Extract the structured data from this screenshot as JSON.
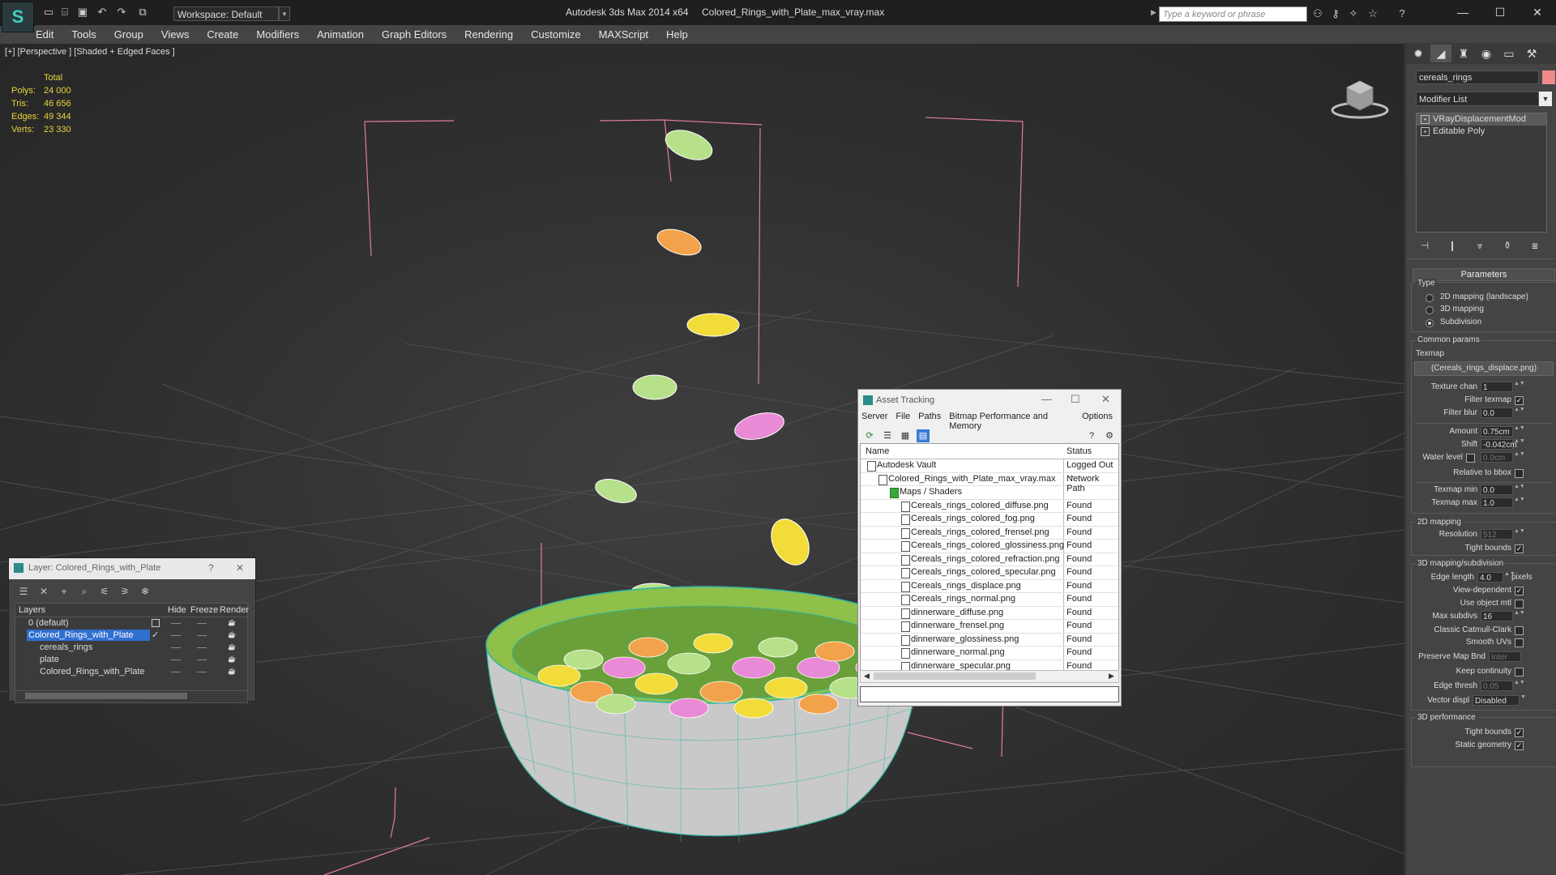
{
  "title_bar": {
    "app_title": "Autodesk 3ds Max  2014 x64",
    "file_title": "Colored_Rings_with_Plate_max_vray.max",
    "workspace": "Workspace: Default",
    "search_placeholder": "Type a keyword or phrase",
    "window_controls": {
      "minimize": "—",
      "maximize": "☐",
      "close": "✕"
    }
  },
  "menu": [
    "Edit",
    "Tools",
    "Group",
    "Views",
    "Create",
    "Modifiers",
    "Animation",
    "Graph Editors",
    "Rendering",
    "Customize",
    "MAXScript",
    "Help"
  ],
  "viewport": {
    "label": "[+] [Perspective ] [Shaded + Edged Faces ]",
    "stats": {
      "header": "Total",
      "rows": [
        {
          "label": "Polys:",
          "value": "24 000"
        },
        {
          "label": "Tris:",
          "value": "46 656"
        },
        {
          "label": "Edges:",
          "value": "49 344"
        },
        {
          "label": "Verts:",
          "value": "23 330"
        }
      ]
    },
    "ring_colors": {
      "green": "#b6e08a",
      "orange": "#f2a24a",
      "yellow": "#f2dc3a",
      "pink": "#e98ad6"
    }
  },
  "command_panel": {
    "object_name": "cereals_rings",
    "object_color": "#f08a8a",
    "modifier_list": "Modifier List",
    "stack": [
      "VRayDisplacementMod",
      "Editable Poly"
    ],
    "parameters_title": "Parameters",
    "type_label": "Type",
    "type_options": [
      "2D mapping (landscape)",
      "3D mapping",
      "Subdivision"
    ],
    "common_params": "Common params",
    "texmap_label": "Texmap",
    "texmap_value": "(Cereals_rings_displace.png)",
    "texture_chan": {
      "label": "Texture chan",
      "value": "1"
    },
    "filter_texmap": "Filter texmap",
    "filter_blur": {
      "label": "Filter blur",
      "value": "0.0"
    },
    "amount": {
      "label": "Amount",
      "value": "0.75cm"
    },
    "shift": {
      "label": "Shift",
      "value": "-0.042cm"
    },
    "water_level": {
      "label": "Water level",
      "value": "0.0cm"
    },
    "relative_bbox": "Relative to bbox",
    "texmap_min": {
      "label": "Texmap min",
      "value": "0.0"
    },
    "texmap_max": {
      "label": "Texmap max",
      "value": "1.0"
    },
    "mapping_2d": "2D mapping",
    "resolution": {
      "label": "Resolution",
      "value": "512"
    },
    "tight_bounds": "Tight bounds",
    "mapping_3d": "3D mapping/subdivision",
    "edge_length": {
      "label": "Edge length",
      "value": "4.0",
      "unit": "pixels"
    },
    "view_dependent": "View-dependent",
    "use_object_mtl": "Use object mtl",
    "max_subdivs": {
      "label": "Max subdivs",
      "value": "16"
    },
    "classic_catmull": "Classic Catmull-Clark",
    "smooth_uvs": "Smooth UVs",
    "preserve_map": {
      "label": "Preserve Map Bnd",
      "value": "Inter"
    },
    "keep_continuity": "Keep continuity",
    "edge_thresh": {
      "label": "Edge thresh",
      "value": "0.05"
    },
    "vector_displ": {
      "label": "Vector displ",
      "value": "Disabled"
    },
    "perf_3d": "3D performance",
    "tight_bounds2": "Tight bounds",
    "static_geometry": "Static geometry"
  },
  "layer_dialog": {
    "title": "Layer: Colored_Rings_with_Plate",
    "help": "?",
    "close": "✕",
    "columns": [
      "Layers",
      "Hide",
      "Freeze",
      "Render"
    ],
    "rows": [
      {
        "name": "0 (default)",
        "indent": 0,
        "selected": false
      },
      {
        "name": "Colored_Rings_with_Plate",
        "indent": 0,
        "selected": true
      },
      {
        "name": "cereals_rings",
        "indent": 1,
        "selected": false
      },
      {
        "name": "plate",
        "indent": 1,
        "selected": false
      },
      {
        "name": "Colored_Rings_with_Plate",
        "indent": 1,
        "selected": false
      }
    ]
  },
  "asset_dialog": {
    "title": "Asset Tracking",
    "menu": [
      "Server",
      "File",
      "Paths",
      "Bitmap Performance and Memory",
      "Options"
    ],
    "columns": [
      "Name",
      "Status"
    ],
    "rows": [
      {
        "name": "Autodesk Vault",
        "status": "Logged Out ...",
        "level": 1
      },
      {
        "name": "Colored_Rings_with_Plate_max_vray.max",
        "status": "Network Path",
        "level": 2
      },
      {
        "name": "Maps / Shaders",
        "status": "",
        "level": 3
      },
      {
        "name": "Cereals_rings_colored_diffuse.png",
        "status": "Found",
        "level": 4
      },
      {
        "name": "Cereals_rings_colored_fog.png",
        "status": "Found",
        "level": 4
      },
      {
        "name": "Cereals_rings_colored_frensel.png",
        "status": "Found",
        "level": 4
      },
      {
        "name": "Cereals_rings_colored_glossiness.png",
        "status": "Found",
        "level": 4
      },
      {
        "name": "Cereals_rings_colored_refraction.png",
        "status": "Found",
        "level": 4
      },
      {
        "name": "Cereals_rings_colored_specular.png",
        "status": "Found",
        "level": 4
      },
      {
        "name": "Cereals_rings_displace.png",
        "status": "Found",
        "level": 4
      },
      {
        "name": "Cereals_rings_normal.png",
        "status": "Found",
        "level": 4
      },
      {
        "name": "dinnerware_diffuse.png",
        "status": "Found",
        "level": 4
      },
      {
        "name": "dinnerware_frensel.png",
        "status": "Found",
        "level": 4
      },
      {
        "name": "dinnerware_glossiness.png",
        "status": "Found",
        "level": 4
      },
      {
        "name": "dinnerware_normal.png",
        "status": "Found",
        "level": 4
      },
      {
        "name": "dinnerware_specular.png",
        "status": "Found",
        "level": 4
      }
    ]
  }
}
